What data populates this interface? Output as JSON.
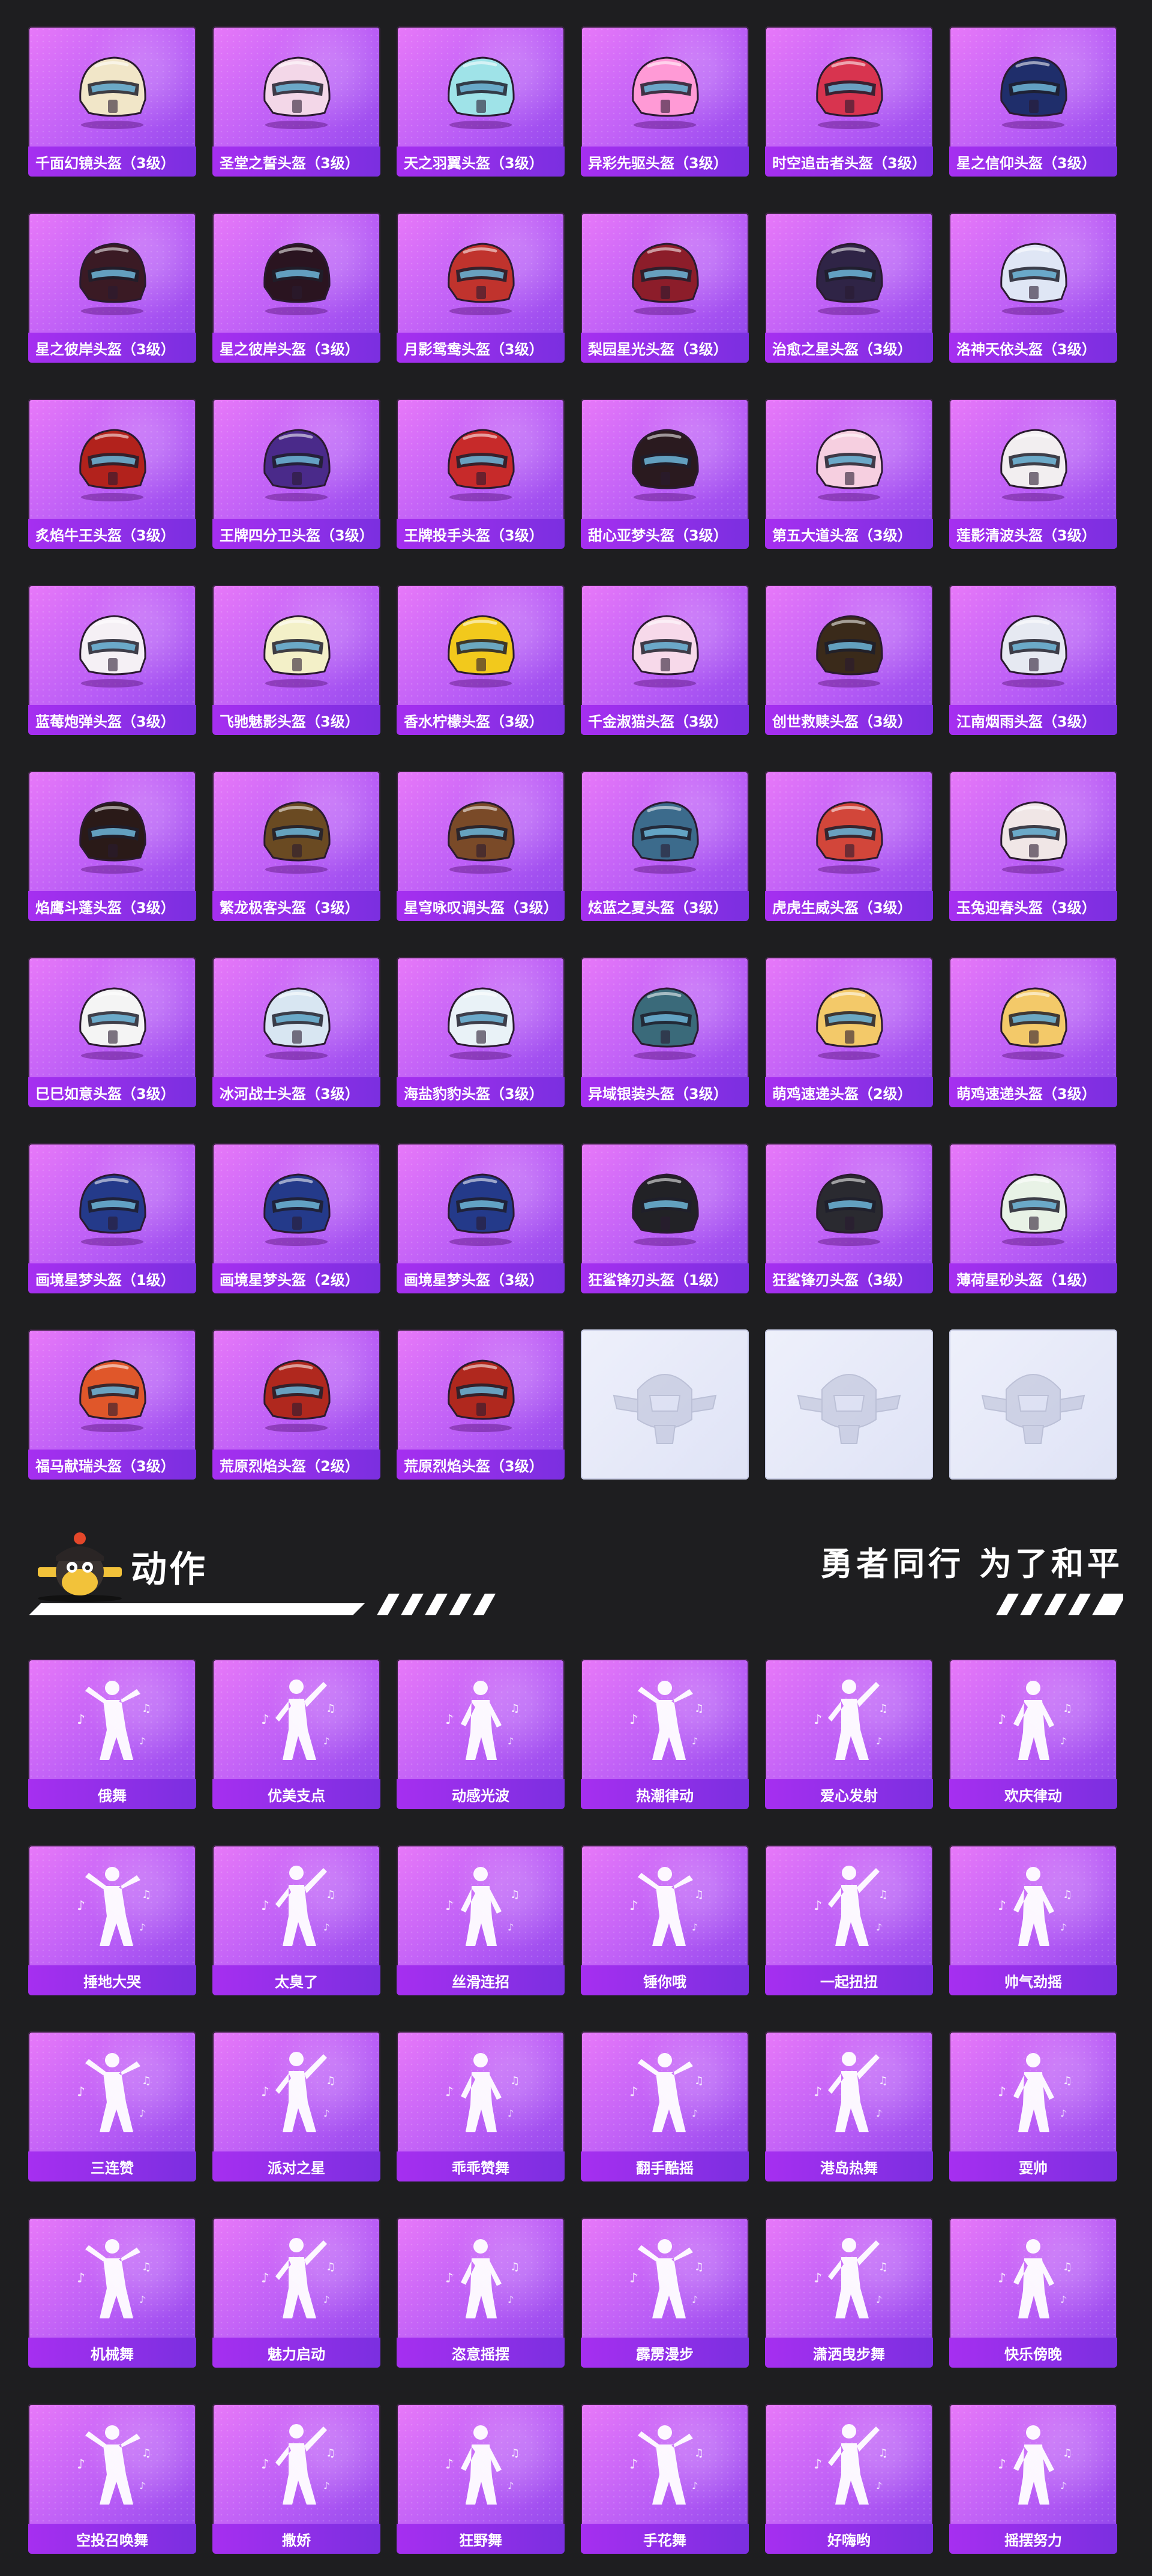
{
  "helmets": [
    {
      "name": "千面幻镜头盔（3级）",
      "color": "#f1e6c8"
    },
    {
      "name": "圣堂之誓头盔（3级）",
      "color": "#f3d7e8"
    },
    {
      "name": "天之羽翼头盔（3级）",
      "color": "#9fe3e8"
    },
    {
      "name": "异彩先驱头盔（3级）",
      "color": "#ff9ad6"
    },
    {
      "name": "时空追击者头盔（3级）",
      "color": "#d8344f"
    },
    {
      "name": "星之信仰头盔（3级）",
      "color": "#1f2e6b"
    },
    {
      "name": "星之彼岸头盔（3级）",
      "color": "#3a1a24"
    },
    {
      "name": "星之彼岸头盔（3级）",
      "color": "#2a1420"
    },
    {
      "name": "月影鸳鸯头盔（3级）",
      "color": "#c0332d"
    },
    {
      "name": "梨园星光头盔（3级）",
      "color": "#8c1d2a"
    },
    {
      "name": "治愈之星头盔（3级）",
      "color": "#2f2446"
    },
    {
      "name": "洛神天依头盔（3级）",
      "color": "#dfe6f5"
    },
    {
      "name": "炙焰牛王头盔（3级）",
      "color": "#b2221c"
    },
    {
      "name": "王牌四分卫头盔（3级）",
      "color": "#4a2a8a"
    },
    {
      "name": "王牌投手头盔（3级）",
      "color": "#c72a2a"
    },
    {
      "name": "甜心亚梦头盔（3级）",
      "color": "#2a1a1f"
    },
    {
      "name": "第五大道头盔（3级）",
      "color": "#f6cfe0"
    },
    {
      "name": "莲影清波头盔（3级）",
      "color": "#f2eef0"
    },
    {
      "name": "蓝莓炮弹头盔（3级）",
      "color": "#f5f0f5"
    },
    {
      "name": "飞驰魅影头盔（3级）",
      "color": "#f3f0c8"
    },
    {
      "name": "香水柠檬头盔（3级）",
      "color": "#f2c91c"
    },
    {
      "name": "千金淑猫头盔（3级）",
      "color": "#f7d9ea"
    },
    {
      "name": "创世救赎头盔（3级）",
      "color": "#3a2a1a"
    },
    {
      "name": "江南烟雨头盔（3级）",
      "color": "#e6e9f2"
    },
    {
      "name": "焰鹰斗蓬头盔（3级）",
      "color": "#2a1a18"
    },
    {
      "name": "繁龙极客头盔（3级）",
      "color": "#6a4a22"
    },
    {
      "name": "星穹咏叹调头盔（3级）",
      "color": "#7a4a28"
    },
    {
      "name": "炫蓝之夏头盔（3级）",
      "color": "#3c6b8c"
    },
    {
      "name": "虎虎生威头盔（3级）",
      "color": "#d2463a"
    },
    {
      "name": "玉兔迎春头盔（3级）",
      "color": "#f0e6e6"
    },
    {
      "name": "巳巳如意头盔（3级）",
      "color": "#f4f4f4"
    },
    {
      "name": "冰河战士头盔（3级）",
      "color": "#d8e6f2"
    },
    {
      "name": "海盐豹豹头盔（3级）",
      "color": "#e9f2f7"
    },
    {
      "name": "异域银装头盔（3级）",
      "color": "#3a6a7a"
    },
    {
      "name": "萌鸡速递头盔（2级）",
      "color": "#f3c969"
    },
    {
      "name": "萌鸡速递头盔（3级）",
      "color": "#f3c969"
    },
    {
      "name": "画境星梦头盔（1级）",
      "color": "#243a8a"
    },
    {
      "name": "画境星梦头盔（2级）",
      "color": "#243a8a"
    },
    {
      "name": "画境星梦头盔（3级）",
      "color": "#243a8a"
    },
    {
      "name": "狂鲨锋刃头盔（1级）",
      "color": "#222226"
    },
    {
      "name": "狂鲨锋刃头盔（3级）",
      "color": "#2a2a30"
    },
    {
      "name": "薄荷星砂头盔（1级）",
      "color": "#e8f2e6"
    },
    {
      "name": "福马献瑞头盔（3级）",
      "color": "#e0572a"
    },
    {
      "name": "荒原烈焰头盔（2级）",
      "color": "#b0281e"
    },
    {
      "name": "荒原烈焰头盔（3级）",
      "color": "#b0281e"
    }
  ],
  "placeholders": 3,
  "section": {
    "title": "动作",
    "slogan": "勇者同行 为了和平"
  },
  "emotes": [
    "俄舞",
    "优美支点",
    "动感光波",
    "热潮律动",
    "爱心发射",
    "欢庆律动",
    "捶地大哭",
    "太臭了",
    "丝滑连招",
    "锤你哦",
    "一起扭扭",
    "帅气劲摇",
    "三连赞",
    "派对之星",
    "乖乖赞舞",
    "翻手酷摇",
    "港岛热舞",
    "耍帅",
    "机械舞",
    "魅力启动",
    "恣意摇摆",
    "霹雳漫步",
    "潇洒曳步舞",
    "快乐傍晚",
    "空投召唤舞",
    "撒娇",
    "狂野舞",
    "手花舞",
    "好嗨哟",
    "摇摆努力"
  ],
  "colors": {
    "background": "#1e1e20",
    "card_gradient_start": "#e879f9",
    "card_gradient_end": "#8b44ea",
    "label_bar": "#a62ff0",
    "placeholder": "#eef0fb"
  }
}
